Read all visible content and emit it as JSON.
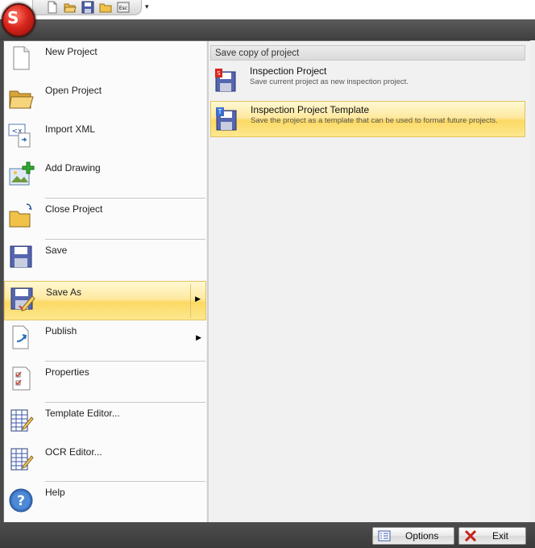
{
  "quick_access": {
    "buttons": [
      "new-file-icon",
      "open-folder-icon",
      "save-disk-icon",
      "folder-icon",
      "esc-icon"
    ],
    "esc_label": "Esc",
    "dropdown_glyph": "▾"
  },
  "app_orb": {
    "letter": "S",
    "icon": "app-logo-icon"
  },
  "menu": {
    "items": [
      {
        "label": "New Project",
        "icon": "new-document-icon"
      },
      {
        "label": "Open Project",
        "icon": "open-folder-icon"
      },
      {
        "label": "Import XML",
        "icon": "import-xml-icon"
      },
      {
        "label": "Add Drawing",
        "icon": "add-drawing-icon"
      },
      {
        "label": "Close Project",
        "icon": "close-folder-icon"
      },
      {
        "label": "Save",
        "icon": "save-disk-icon"
      },
      {
        "label": "Save As",
        "icon": "save-as-icon",
        "selected": true,
        "submenu": true
      },
      {
        "label": "Publish",
        "icon": "publish-icon",
        "submenu": true
      },
      {
        "label": "Properties",
        "icon": "properties-checklist-icon"
      },
      {
        "label": "Template Editor...",
        "icon": "template-editor-icon"
      },
      {
        "label": "OCR Editor...",
        "icon": "ocr-editor-icon"
      },
      {
        "label": "Help",
        "icon": "help-icon"
      }
    ],
    "arrow_glyph": "▶"
  },
  "submenu": {
    "header": "Save copy of project",
    "items": [
      {
        "title": "Inspection Project",
        "desc": "Save current project as new inspection project.",
        "icon": "save-pdf-icon"
      },
      {
        "title": "Inspection Project Template",
        "desc": "Save the project as a template that can be used to format future projects.",
        "icon": "save-template-icon",
        "selected": true
      }
    ]
  },
  "footer": {
    "options_label": "Options",
    "exit_label": "Exit"
  },
  "colors": {
    "highlight": "#fde88f",
    "highlight_border": "#e3c35e",
    "orb": "#d9261d",
    "chrome": "#4a4a4a"
  }
}
